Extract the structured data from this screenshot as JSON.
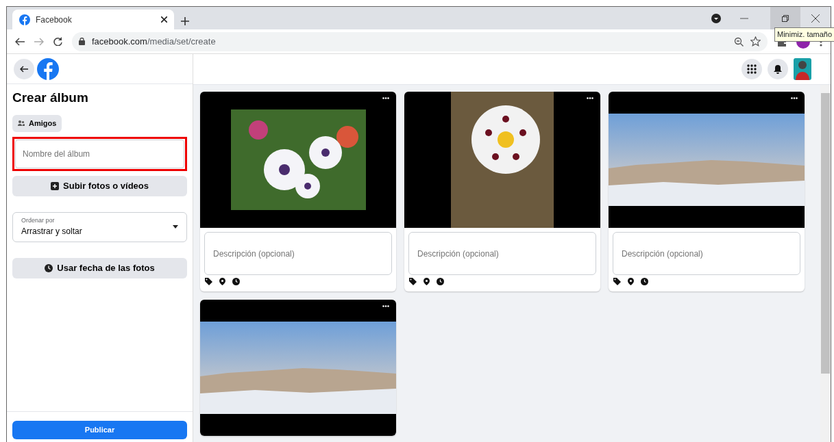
{
  "browser": {
    "tab_title": "Facebook",
    "url_host": "facebook.com",
    "url_path": "/media/set/create",
    "tooltip": "Minimiz. tamaño"
  },
  "sidebar": {
    "title": "Crear álbum",
    "audience_button": "Amigos",
    "name_field": {
      "placeholder": "Nombre del álbum",
      "highlighted": true
    },
    "upload_button": "Subir fotos o vídeos",
    "sort_select": {
      "label": "Ordenar por",
      "value": "Arrastrar y soltar"
    },
    "date_button": "Usar fecha de las fotos",
    "publish_button": "Publicar"
  },
  "photos": [
    {
      "kind": "flowers",
      "description_placeholder": "Descripción (opcional)"
    },
    {
      "kind": "flower-portrait",
      "description_placeholder": "Descripción (opcional)"
    },
    {
      "kind": "landscape",
      "description_placeholder": "Descripción (opcional)"
    },
    {
      "kind": "landscape"
    }
  ]
}
